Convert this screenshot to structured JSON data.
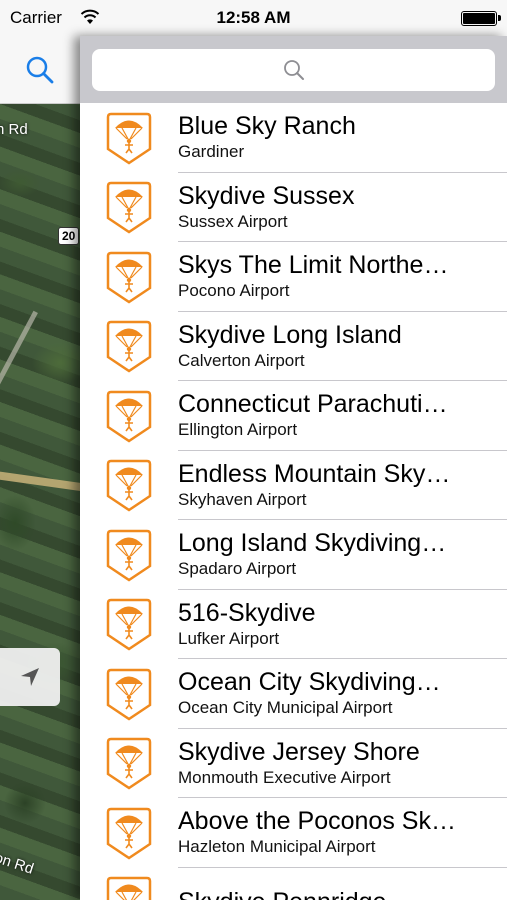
{
  "status_bar": {
    "carrier": "Carrier",
    "time": "12:58 AM"
  },
  "map": {
    "labels": [
      "n Rd",
      "on Rd"
    ],
    "route_shield": "20"
  },
  "search": {
    "placeholder": ""
  },
  "colors": {
    "pin_orange": "#f08a1e",
    "separator": "#c8c7cc",
    "searchbar_bg": "#c8c8cd",
    "accent": "#1a7ee8"
  },
  "dropzones": [
    {
      "name": "Blue Sky Ranch",
      "location": "Gardiner"
    },
    {
      "name": "Skydive Sussex",
      "location": "Sussex Airport"
    },
    {
      "name": "Skys The Limit Northe…",
      "location": "Pocono Airport"
    },
    {
      "name": "Skydive Long Island",
      "location": "Calverton Airport"
    },
    {
      "name": "Connecticut Parachuti…",
      "location": "Ellington Airport"
    },
    {
      "name": "Endless Mountain Sky…",
      "location": "Skyhaven Airport"
    },
    {
      "name": "Long Island Skydiving…",
      "location": "Spadaro Airport"
    },
    {
      "name": "516-Skydive",
      "location": "Lufker Airport"
    },
    {
      "name": "Ocean City Skydiving…",
      "location": "Ocean City Municipal Airport"
    },
    {
      "name": "Skydive Jersey Shore",
      "location": "Monmouth Executive Airport"
    },
    {
      "name": "Above the Poconos Sk…",
      "location": "Hazleton Municipal Airport"
    },
    {
      "name": "Skydive Pennridge",
      "location": ""
    }
  ]
}
